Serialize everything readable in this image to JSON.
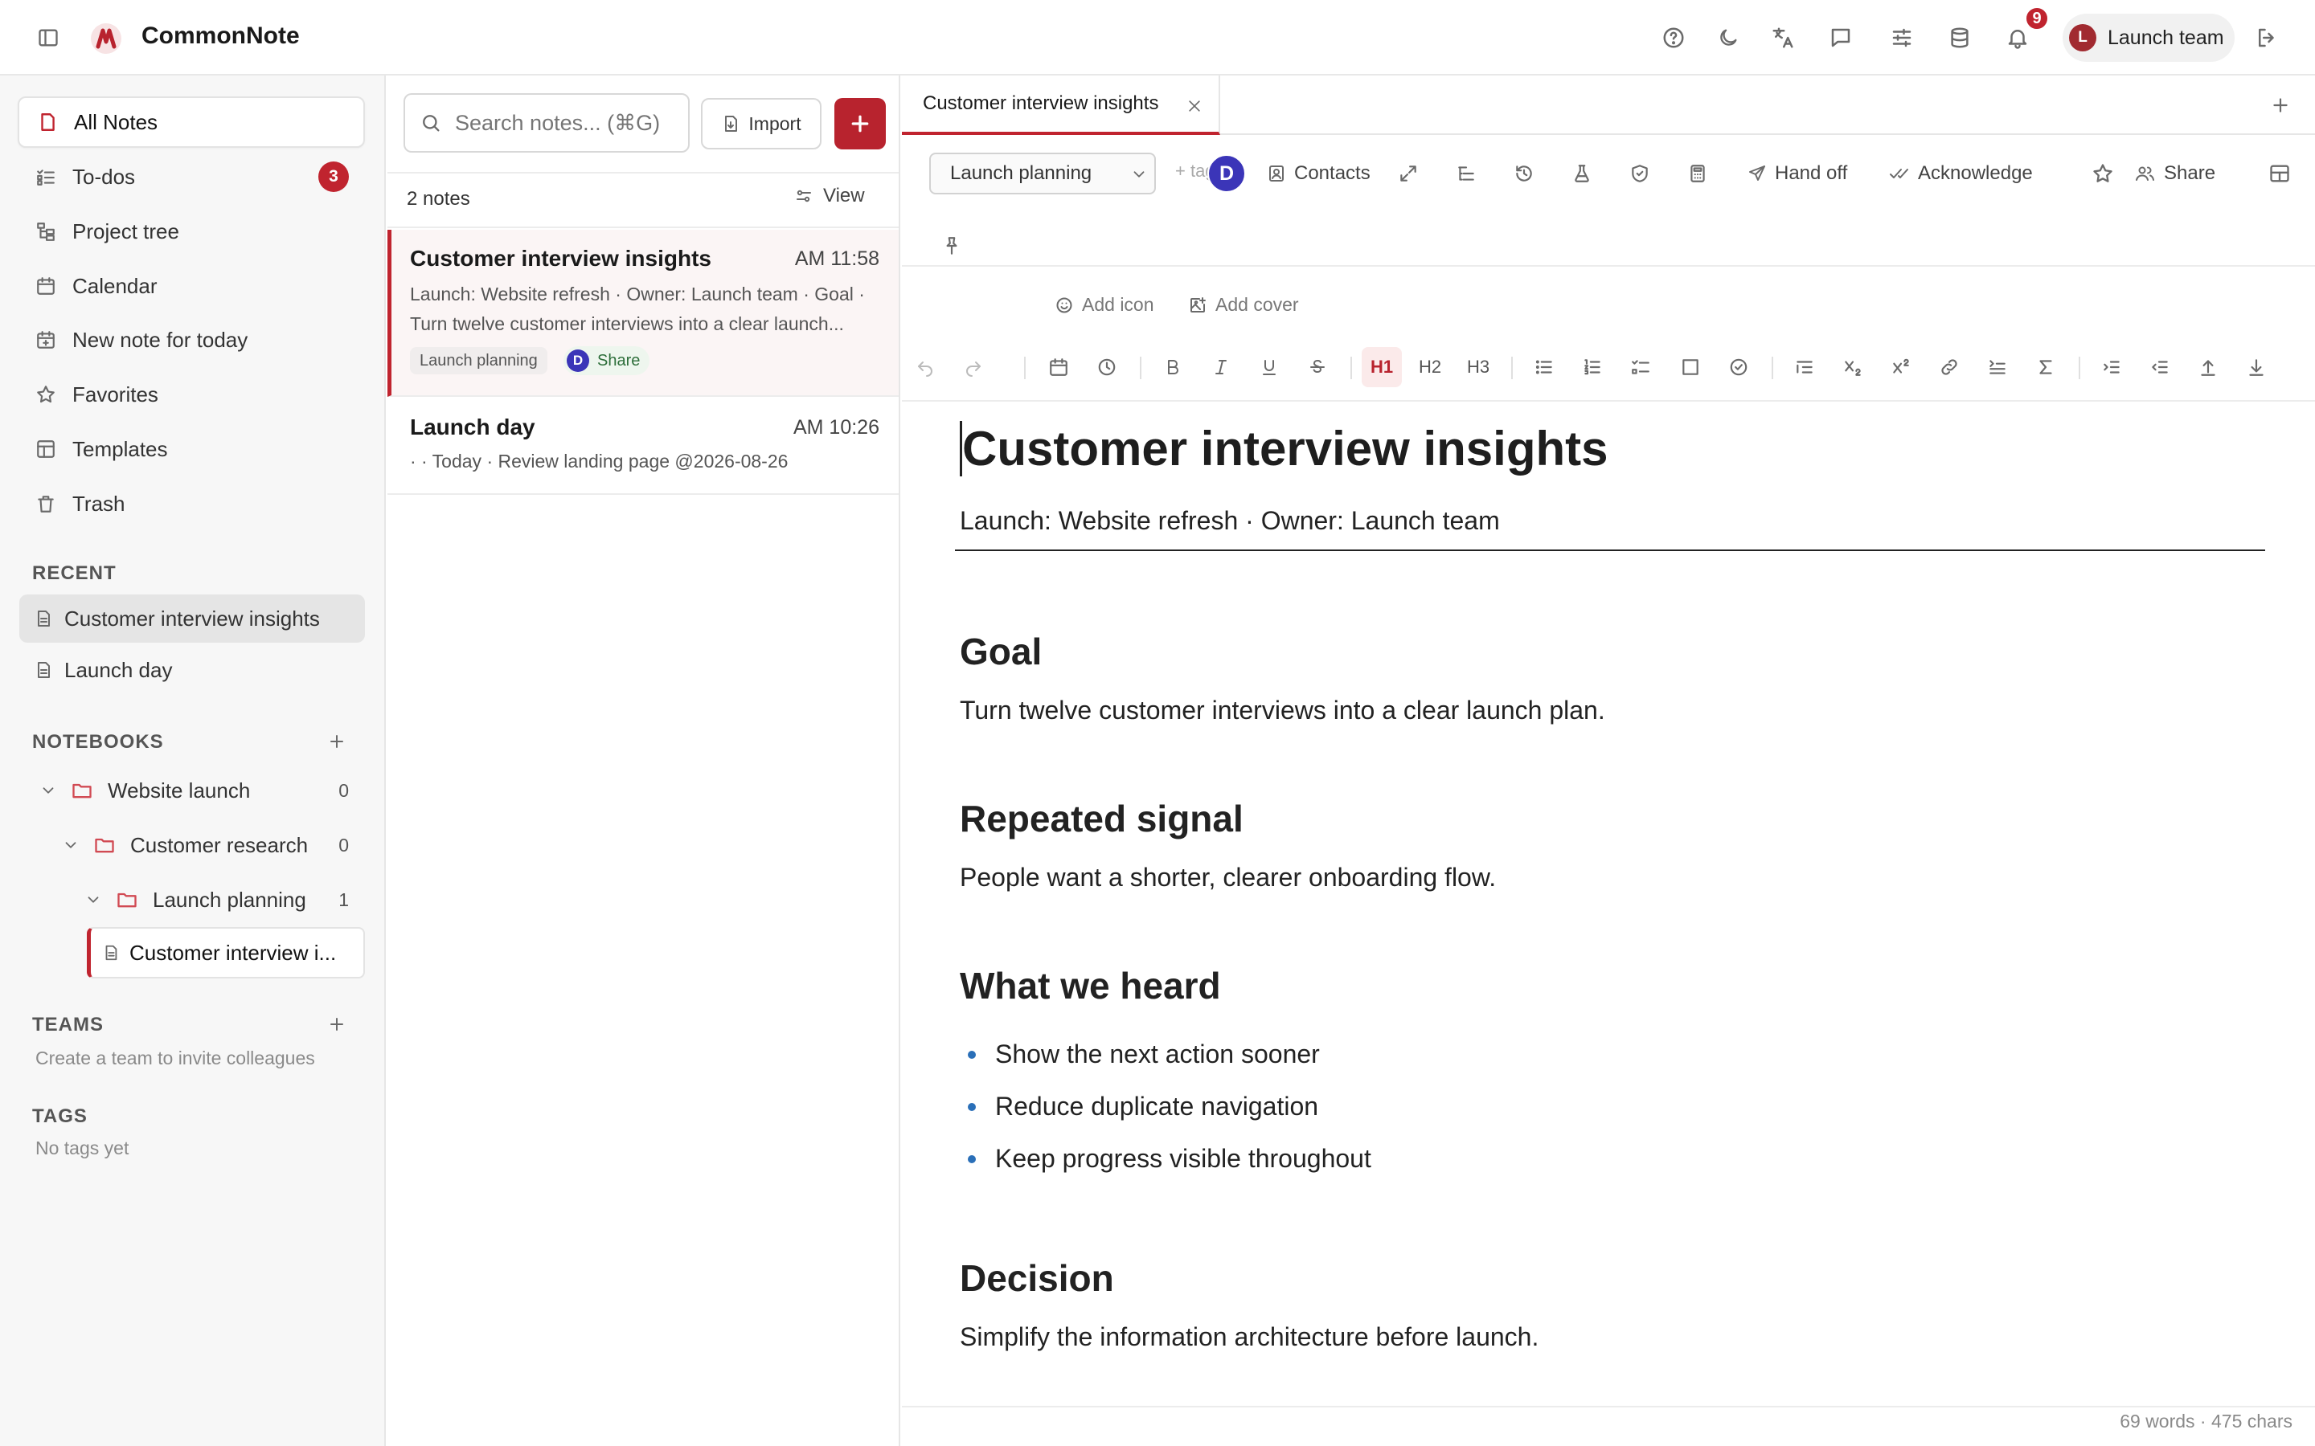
{
  "app": {
    "title": "CommonNote",
    "brand_color": "#c0242f",
    "notifications_count": "9",
    "user": {
      "initial": "L",
      "name": "Launch team"
    }
  },
  "topbar_icons": [
    "sidebar-toggle-icon",
    "help-icon",
    "moon-icon",
    "translate-icon",
    "chat-icon",
    "sliders-icon",
    "database-icon",
    "bell-icon",
    "logout-icon"
  ],
  "sidebar": {
    "nav": [
      {
        "label": "All Notes",
        "icon": "note-icon",
        "active": true
      },
      {
        "label": "To-dos",
        "icon": "todo-icon",
        "badge": "3"
      },
      {
        "label": "Project tree",
        "icon": "tree-icon"
      },
      {
        "label": "Calendar",
        "icon": "calendar-icon"
      },
      {
        "label": "New note for today",
        "icon": "calendar-plus-icon"
      },
      {
        "label": "Favorites",
        "icon": "star-icon"
      },
      {
        "label": "Templates",
        "icon": "template-icon"
      },
      {
        "label": "Trash",
        "icon": "trash-icon"
      }
    ],
    "recent_label": "RECENT",
    "recent": [
      "Customer interview insights",
      "Launch day"
    ],
    "notebooks_label": "NOTEBOOKS",
    "notebooks": [
      {
        "label": "Website launch",
        "count": "0"
      },
      {
        "label": "Customer research",
        "count": "0"
      },
      {
        "label": "Launch planning",
        "count": "1"
      },
      {
        "label": "Customer interview i..."
      }
    ],
    "teams_label": "TEAMS",
    "teams_hint": "Create a team to invite colleagues",
    "tags_label": "TAGS",
    "tags_hint": "No tags yet"
  },
  "notelist": {
    "search_placeholder": "Search notes... (⌘G)",
    "import_label": "Import",
    "count_label": "2 notes",
    "view_label": "View",
    "notes": [
      {
        "title": "Customer interview insights",
        "time": "AM 11:58",
        "snippet": "Launch: Website refresh · Owner: Launch team · Goal · Turn twelve customer interviews into a clear launch...",
        "tag": "Launch planning",
        "share_initial": "D",
        "share_label": "Share"
      },
      {
        "title": "Launch day",
        "time": "AM 10:26",
        "snippet": "· · Today · Review landing page @2026-08-26"
      }
    ]
  },
  "editor": {
    "tab_title": "Customer interview insights",
    "notebook_select": "Launch planning",
    "add_tag_placeholder": "+ tag",
    "presence_initial": "D",
    "contacts_label": "Contacts",
    "handoff_label": "Hand off",
    "acknowledge_label": "Acknowledge",
    "share_label": "Share",
    "add_icon_label": "Add icon",
    "add_cover_label": "Add cover",
    "format": {
      "h1": "H1",
      "h2": "H2",
      "h3": "H3"
    },
    "doc": {
      "title": "Customer interview insights",
      "meta": "Launch: Website refresh · Owner: Launch team",
      "sections": [
        {
          "heading": "Goal",
          "text": "Turn twelve customer interviews into a clear launch plan."
        },
        {
          "heading": "Repeated signal",
          "text": "People want a shorter, clearer onboarding flow."
        },
        {
          "heading": "What we heard",
          "bullets": [
            "Show the next action sooner",
            "Reduce duplicate navigation",
            "Keep progress visible throughout"
          ]
        },
        {
          "heading": "Decision",
          "text": "Simplify the information architecture before launch."
        }
      ]
    },
    "status": "69 words · 475 chars"
  }
}
